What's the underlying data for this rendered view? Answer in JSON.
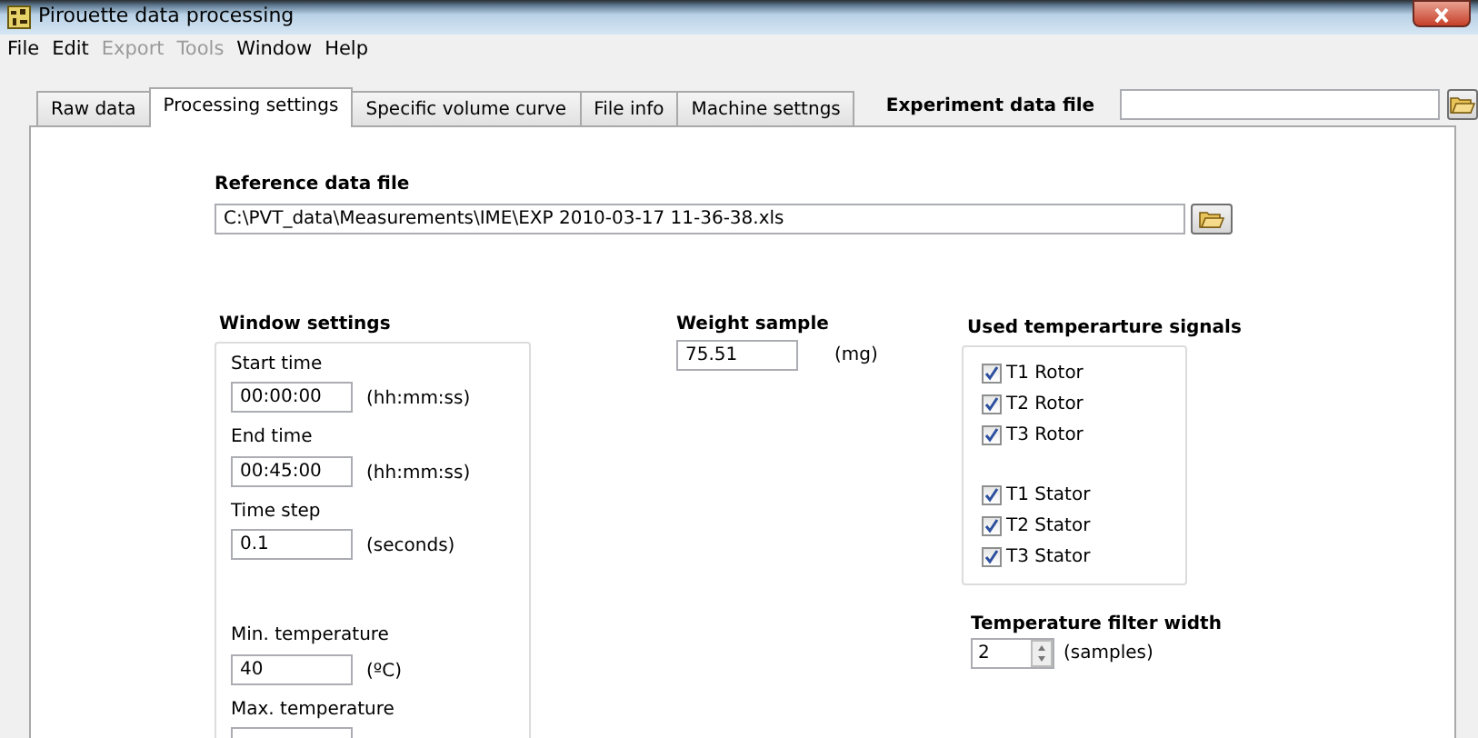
{
  "window": {
    "title": "Pirouette data processing"
  },
  "menu": [
    {
      "label": "File",
      "disabled": false
    },
    {
      "label": "Edit",
      "disabled": false
    },
    {
      "label": "Export",
      "disabled": true
    },
    {
      "label": "Tools",
      "disabled": true
    },
    {
      "label": "Window",
      "disabled": false
    },
    {
      "label": "Help",
      "disabled": false
    }
  ],
  "tabs": [
    {
      "label": "Raw data",
      "selected": false
    },
    {
      "label": "Processing settings",
      "selected": true
    },
    {
      "label": "Specific volume curve",
      "selected": false
    },
    {
      "label": "File info",
      "selected": false
    },
    {
      "label": "Machine settngs",
      "selected": false
    }
  ],
  "experiment_file": {
    "label": "Experiment data file"
  },
  "reference_file": {
    "label": "Reference data file",
    "value": "C:\\PVT_data\\Measurements\\IME\\EXP 2010-03-17 11-36-38.xls"
  },
  "window_settings": {
    "title": "Window settings",
    "groups": [
      [
        {
          "label": "Start time",
          "value": "00:00:00",
          "unit": "(hh:mm:ss)"
        },
        {
          "label": "End time",
          "value": "00:45:00",
          "unit": "(hh:mm:ss)"
        },
        {
          "label": "Time step",
          "value": "0.1",
          "unit": "(seconds)"
        }
      ],
      [
        {
          "label": "Min. temperature",
          "value": "40",
          "unit": "(ºC)"
        },
        {
          "label": "Max. temperature"
        }
      ]
    ]
  },
  "weight_sample": {
    "label": "Weight sample",
    "value": "75.51",
    "unit": "(mg)"
  },
  "temperature_signals": {
    "title": "Used temperarture signals",
    "groups": [
      [
        {
          "label": "T1 Rotor",
          "checked": true
        },
        {
          "label": "T2 Rotor",
          "checked": true
        },
        {
          "label": "T3 Rotor",
          "checked": true
        }
      ],
      [
        {
          "label": "T1 Stator",
          "checked": true
        },
        {
          "label": "T2 Stator",
          "checked": true
        },
        {
          "label": "T3 Stator",
          "checked": true
        }
      ]
    ]
  },
  "filter_width": {
    "label": "Temperature filter width",
    "value": "2",
    "unit": "(samples)"
  }
}
